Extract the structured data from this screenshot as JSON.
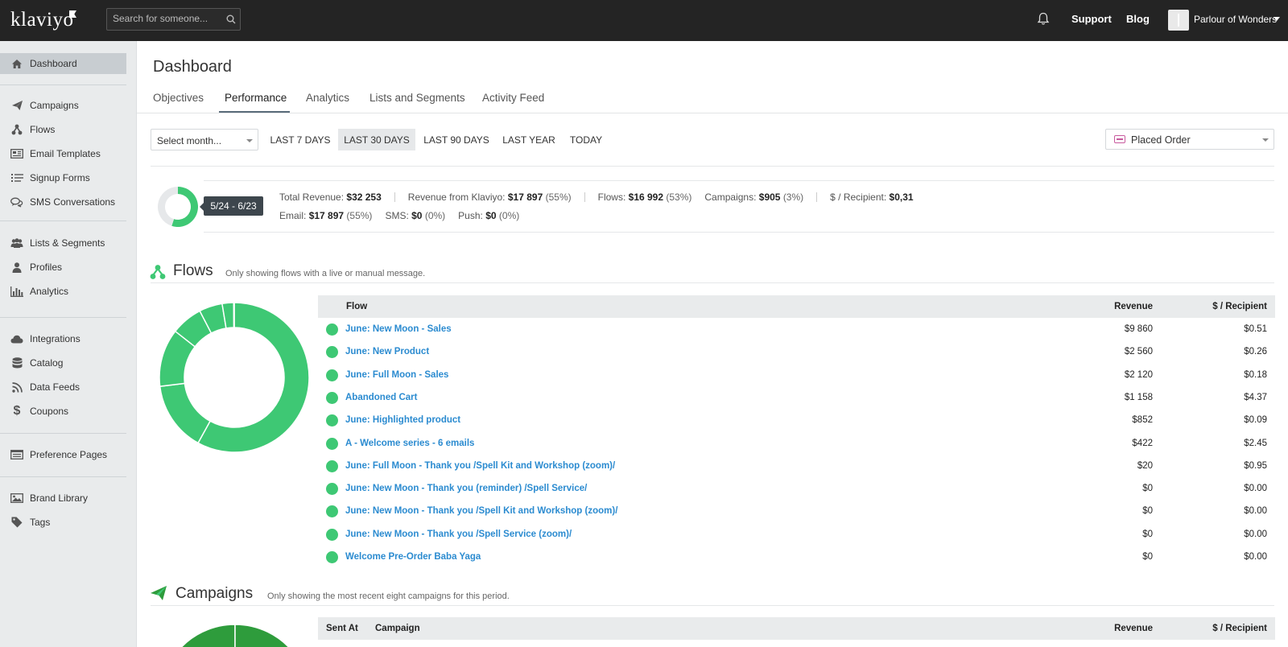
{
  "topbar": {
    "logo": "klaviyo",
    "search_placeholder": "Search for someone...",
    "support": "Support",
    "blog": "Blog",
    "account": "Parlour of Wonders"
  },
  "sidebar": {
    "items": [
      {
        "label": "Dashboard",
        "icon": "home-icon"
      },
      {
        "label": "Campaigns",
        "icon": "paper-plane-icon"
      },
      {
        "label": "Flows",
        "icon": "flow-icon"
      },
      {
        "label": "Email Templates",
        "icon": "template-icon"
      },
      {
        "label": "Signup Forms",
        "icon": "form-icon"
      },
      {
        "label": "SMS Conversations",
        "icon": "chat-icon"
      },
      {
        "label": "Lists & Segments",
        "icon": "users-icon"
      },
      {
        "label": "Profiles",
        "icon": "user-icon"
      },
      {
        "label": "Analytics",
        "icon": "bar-chart-icon"
      },
      {
        "label": "Integrations",
        "icon": "cloud-icon"
      },
      {
        "label": "Catalog",
        "icon": "database-icon"
      },
      {
        "label": "Data Feeds",
        "icon": "rss-icon"
      },
      {
        "label": "Coupons",
        "icon": "dollar-icon"
      },
      {
        "label": "Preference Pages",
        "icon": "page-icon"
      },
      {
        "label": "Brand Library",
        "icon": "image-icon"
      },
      {
        "label": "Tags",
        "icon": "tag-icon"
      }
    ]
  },
  "page": {
    "title": "Dashboard",
    "tabs": [
      "Objectives",
      "Performance",
      "Analytics",
      "Lists and Segments",
      "Activity Feed"
    ],
    "active_tab": "Performance"
  },
  "filters": {
    "month_placeholder": "Select month...",
    "ranges": [
      "LAST 7 DAYS",
      "LAST 30 DAYS",
      "LAST 90 DAYS",
      "LAST YEAR",
      "TODAY"
    ],
    "active_range": "LAST 30 DAYS",
    "metric": "Placed Order"
  },
  "summary": {
    "date_range": "5/24 - 6/23",
    "klaviyo_share": 0.55,
    "colors": {
      "klaviyo": "#3ec874",
      "other": "#e6e8ea",
      "flows_accent": "#3ec874",
      "campaigns_accent": "#2e9c3c"
    },
    "row1": [
      {
        "label": "Total Revenue:",
        "value": "$32 253",
        "pct": ""
      },
      {
        "label": "Revenue from Klaviyo:",
        "value": "$17 897",
        "pct": "(55%)"
      },
      {
        "label": "Flows:",
        "value": "$16 992",
        "pct": "(53%)"
      },
      {
        "label": "Campaigns:",
        "value": "$905",
        "pct": "(3%)"
      },
      {
        "label": "$ / Recipient:",
        "value": "$0,31",
        "pct": ""
      }
    ],
    "row2": [
      {
        "label": "Email:",
        "value": "$17 897",
        "pct": "(55%)"
      },
      {
        "label": "SMS:",
        "value": "$0",
        "pct": "(0%)"
      },
      {
        "label": "Push:",
        "value": "$0",
        "pct": "(0%)"
      }
    ]
  },
  "flows": {
    "title": "Flows",
    "note": "Only showing flows with a live or manual message.",
    "headers": {
      "flow": "Flow",
      "revenue": "Revenue",
      "per_recipient": "$ / Recipient"
    },
    "rows": [
      {
        "name": "June: New Moon - Sales",
        "revenue": "$9 860",
        "per_recipient": "$0.51"
      },
      {
        "name": "June: New Product",
        "revenue": "$2 560",
        "per_recipient": "$0.26"
      },
      {
        "name": "June: Full Moon - Sales",
        "revenue": "$2 120",
        "per_recipient": "$0.18"
      },
      {
        "name": "Abandoned Cart",
        "revenue": "$1 158",
        "per_recipient": "$4.37"
      },
      {
        "name": "June: Highlighted product",
        "revenue": "$852",
        "per_recipient": "$0.09"
      },
      {
        "name": "A - Welcome series - 6 emails",
        "revenue": "$422",
        "per_recipient": "$2.45"
      },
      {
        "name": "June: Full Moon - Thank you /Spell Kit and Workshop (zoom)/",
        "revenue": "$20",
        "per_recipient": "$0.95"
      },
      {
        "name": "June: New Moon - Thank you (reminder) /Spell Service/",
        "revenue": "$0",
        "per_recipient": "$0.00"
      },
      {
        "name": "June: New Moon - Thank you /Spell Kit and Workshop (zoom)/",
        "revenue": "$0",
        "per_recipient": "$0.00"
      },
      {
        "name": "June: New Moon - Thank you /Spell Service (zoom)/",
        "revenue": "$0",
        "per_recipient": "$0.00"
      },
      {
        "name": "Welcome Pre-Order Baba Yaga",
        "revenue": "$0",
        "per_recipient": "$0.00"
      }
    ],
    "donut_values": [
      9860,
      2560,
      2120,
      1158,
      852,
      422,
      20
    ]
  },
  "campaigns": {
    "title": "Campaigns",
    "note": "Only showing the most recent eight campaigns for this period.",
    "headers": {
      "sent_at": "Sent At",
      "campaign": "Campaign",
      "revenue": "Revenue",
      "per_recipient": "$ / Recipient"
    }
  }
}
